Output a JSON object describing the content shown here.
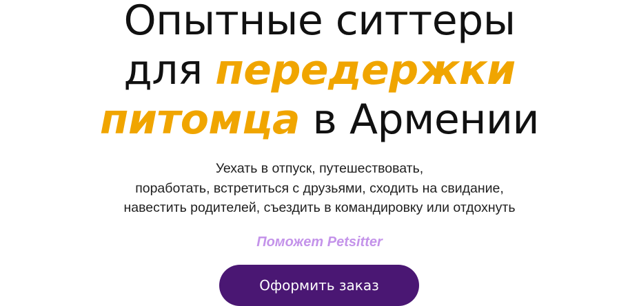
{
  "hero": {
    "title": {
      "line1": "Опытные ситтеры",
      "line2_prefix": "для ",
      "line2_accent": "передержки",
      "line3_accent": "питомца",
      "line3_suffix": " в Армении"
    },
    "subtitle": {
      "line1": "Уехать в отпуск, путешествовать,",
      "line2": "поработать, встретиться с друзьями, сходить на свидание,",
      "line3": "навестить родителей, съездить в командировку или отдохнуть"
    },
    "tagline": "Поможет Petsitter",
    "cta_label": "Оформить заказ"
  },
  "colors": {
    "accent": "#f0a500",
    "tagline": "#c493ea",
    "button_bg": "#4a1773",
    "button_text": "#ffffff"
  }
}
